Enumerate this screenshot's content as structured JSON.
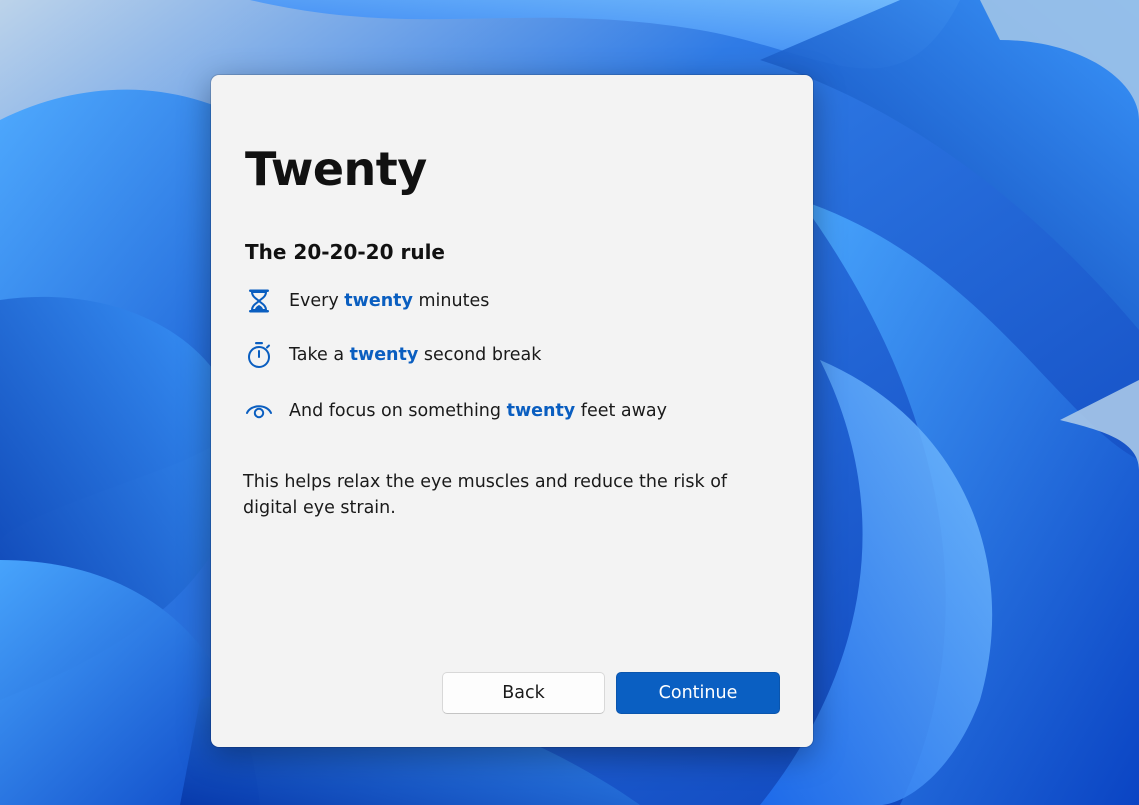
{
  "dialog": {
    "title": "Twenty",
    "subtitle": "The 20-20-20 rule",
    "rules": [
      {
        "icon": "hourglass-icon",
        "before": "Every ",
        "highlight": "twenty",
        "after": " minutes"
      },
      {
        "icon": "stopwatch-icon",
        "before": "Take a ",
        "highlight": "twenty",
        "after": " second break"
      },
      {
        "icon": "eye-icon",
        "before": "And focus on something ",
        "highlight": "twenty",
        "after": " feet away"
      }
    ],
    "note": "This helps relax the eye muscles and reduce the risk of digital eye strain.",
    "back_label": "Back",
    "continue_label": "Continue"
  },
  "colors": {
    "accent": "#0a5fc2",
    "highlight_text": "#0a5ec0",
    "dialog_bg": "#f3f3f3",
    "wallpaper": "#1d5fd9"
  }
}
